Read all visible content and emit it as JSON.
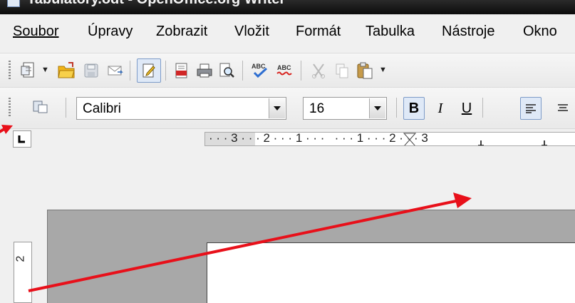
{
  "window": {
    "title": "Tabulátory.odt - OpenOffice.org Writer"
  },
  "menubar": {
    "items": [
      {
        "label": "Soubor"
      },
      {
        "label": "Úpravy"
      },
      {
        "label": "Zobrazit"
      },
      {
        "label": "Vložit"
      },
      {
        "label": "Formát"
      },
      {
        "label": "Tabulka"
      },
      {
        "label": "Nástroje"
      },
      {
        "label": "Okno"
      }
    ]
  },
  "formatting": {
    "font_name": "Calibri",
    "font_size": "16",
    "bold": "B",
    "italic": "I",
    "underline": "U"
  },
  "ruler": {
    "text": "· · · 3 · · · 2 · · · 1 · · ·   · · · 1 · · · 2 · · · 3"
  },
  "vertical_ruler": {
    "text": "2"
  },
  "icons": {
    "titlebar": "document-icon",
    "toolbar1": [
      "new-document-icon",
      "open-folder-icon",
      "save-icon",
      "email-icon",
      "edit-file-icon",
      "export-pdf-icon",
      "print-icon",
      "page-preview-icon",
      "spellcheck-icon",
      "autospellcheck-icon",
      "cut-icon",
      "copy-icon",
      "paste-icon"
    ],
    "toolbar2": [
      "styles-icon",
      "align-left-icon",
      "align-center-icon"
    ]
  },
  "colors": {
    "annotation_arrow": "#e8101a",
    "active_button_border": "#7d9bc8"
  }
}
